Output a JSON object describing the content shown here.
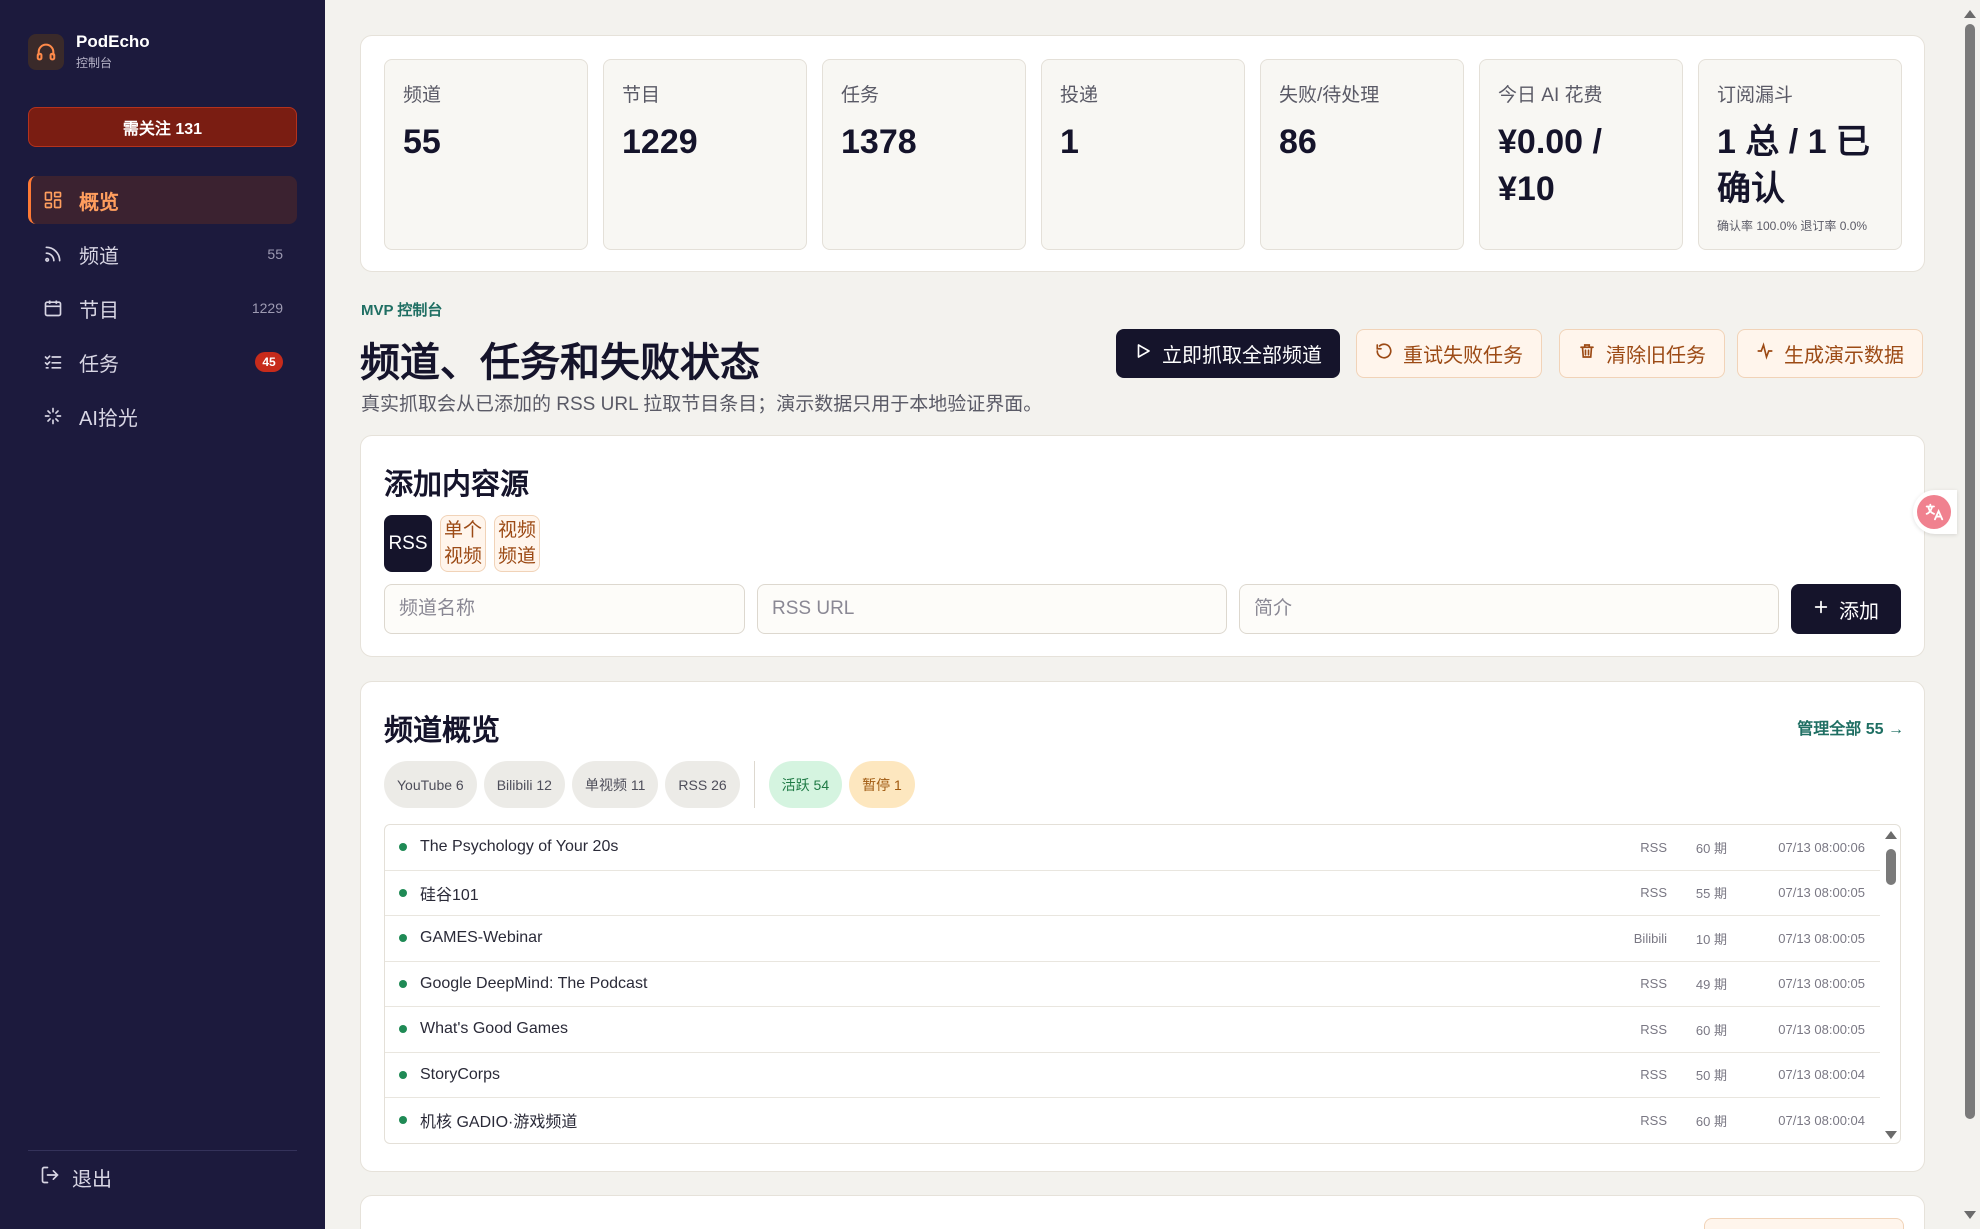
{
  "brand": {
    "name": "PodEcho",
    "subtitle": "控制台"
  },
  "attention": {
    "label": "需关注 131"
  },
  "nav": {
    "items": [
      {
        "label": "概览",
        "count": "",
        "icon": "dashboard-icon"
      },
      {
        "label": "频道",
        "count": "55",
        "icon": "rss-icon"
      },
      {
        "label": "节目",
        "count": "1229",
        "icon": "calendar-icon"
      },
      {
        "label": "任务",
        "badge": "45",
        "icon": "tasks-icon"
      },
      {
        "label": "AI拾光",
        "count": "",
        "icon": "sparkles-icon"
      }
    ],
    "logout": "退出"
  },
  "stats": [
    {
      "label": "频道",
      "value": "55"
    },
    {
      "label": "节目",
      "value": "1229"
    },
    {
      "label": "任务",
      "value": "1378"
    },
    {
      "label": "投递",
      "value": "1"
    },
    {
      "label": "失败/待处理",
      "value": "86"
    },
    {
      "label": "今日 AI 花费",
      "value": "¥0.00 / ¥10"
    },
    {
      "label": "订阅漏斗",
      "value": "1 总 / 1 已确认",
      "note": "确认率 100.0% 退订率 0.0%"
    }
  ],
  "header": {
    "eyebrow": "MVP 控制台",
    "title": "频道、任务和失败状态",
    "description": "真实抓取会从已添加的 RSS URL 拉取节目条目；演示数据只用于本地验证界面。"
  },
  "actions": {
    "fetch_all": "立即抓取全部频道",
    "retry_failed": "重试失败任务",
    "clear_old": "清除旧任务",
    "generate_demo": "生成演示数据"
  },
  "add_source": {
    "title": "添加内容源",
    "tabs": [
      "RSS",
      "单个视频",
      "视频频道"
    ],
    "name_placeholder": "频道名称",
    "url_placeholder": "RSS URL",
    "intro_placeholder": "简介",
    "add_label": "添加"
  },
  "overview": {
    "title": "频道概览",
    "manage_link": "管理全部 55 →",
    "filters": [
      "YouTube 6",
      "Bilibili 12",
      "单视频 11",
      "RSS 26"
    ],
    "status_filters": [
      "活跃 54",
      "暂停 1"
    ],
    "rows": [
      {
        "name": "The Psychology of Your 20s",
        "source": "RSS",
        "count": "60 期",
        "time": "07/13 08:00:06"
      },
      {
        "name": "硅谷101",
        "source": "RSS",
        "count": "55 期",
        "time": "07/13 08:00:05"
      },
      {
        "name": "GAMES-Webinar",
        "source": "Bilibili",
        "count": "10 期",
        "time": "07/13 08:00:05"
      },
      {
        "name": "Google DeepMind: The Podcast",
        "source": "RSS",
        "count": "49 期",
        "time": "07/13 08:00:05"
      },
      {
        "name": "What's Good Games",
        "source": "RSS",
        "count": "60 期",
        "time": "07/13 08:00:05"
      },
      {
        "name": "StoryCorps",
        "source": "RSS",
        "count": "50 期",
        "time": "07/13 08:00:04"
      },
      {
        "name": "机核 GADIO·游戏频道",
        "source": "RSS",
        "count": "60 期",
        "time": "07/13 08:00:04"
      }
    ]
  },
  "colors": {
    "sidebar_bg": "#1c1a3d",
    "accent_orange": "#ff7a35",
    "attention_red": "#7a1d12",
    "primary_dark": "#15142b",
    "accent_green": "#1f6f63"
  }
}
